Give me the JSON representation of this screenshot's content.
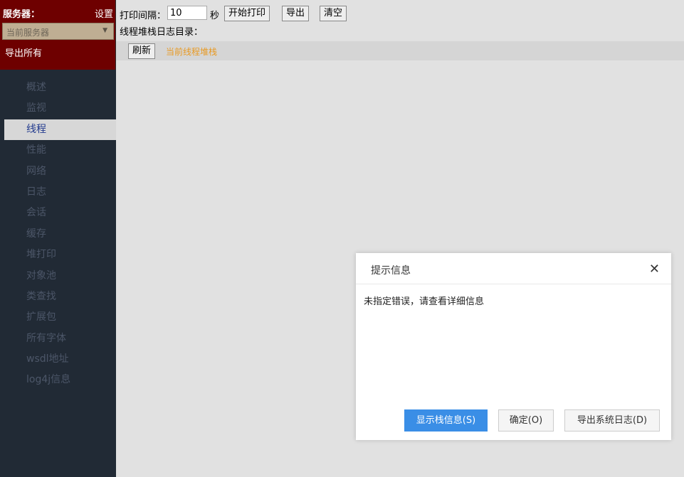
{
  "sidebar": {
    "server_title": "服务器：",
    "settings_label": "设置",
    "server_select": "当前服务器",
    "export_all": "导出所有",
    "items": [
      {
        "label": "概述"
      },
      {
        "label": "监视"
      },
      {
        "label": "线程"
      },
      {
        "label": "性能"
      },
      {
        "label": "网络"
      },
      {
        "label": "日志"
      },
      {
        "label": "会话"
      },
      {
        "label": "缓存"
      },
      {
        "label": "堆打印"
      },
      {
        "label": "对象池"
      },
      {
        "label": "类查找"
      },
      {
        "label": "扩展包"
      },
      {
        "label": "所有字体"
      },
      {
        "label": "wsdl地址"
      },
      {
        "label": "log4j信息"
      }
    ],
    "active_item": "线程"
  },
  "toolbar": {
    "interval_label": "打印间隔：",
    "interval_value": "10",
    "unit": "秒",
    "start_print": "开始打印",
    "export": "导出",
    "clear": "清空"
  },
  "log_dir_label": "线程堆栈日志目录：",
  "subbar": {
    "refresh": "刷新",
    "current_stack": "当前线程堆栈"
  },
  "dialog": {
    "title": "提示信息",
    "message": "未指定错误，请查看详细信息",
    "show_stack": "显示栈信息(S)",
    "ok": "确定(O)",
    "export_log": "导出系统日志(D)"
  },
  "colors": {
    "sidebar_bg": "#212a35",
    "sidebar_header_bg": "#6e0000",
    "link_orange": "#e89a24",
    "primary_blue": "#3a8ee6"
  }
}
